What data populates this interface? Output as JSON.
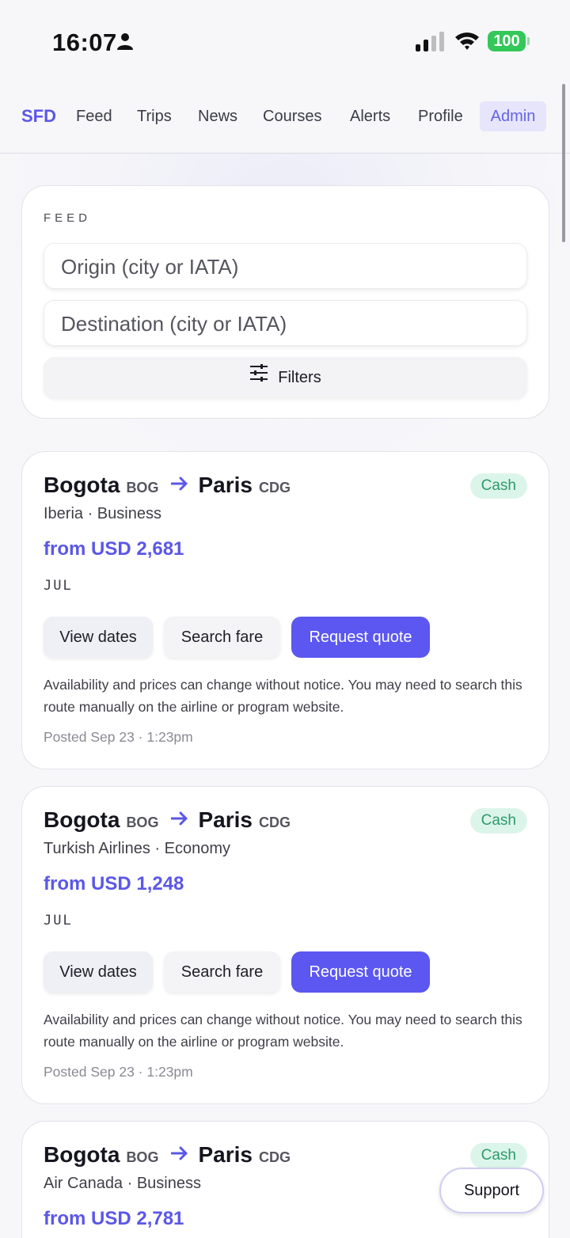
{
  "status_bar": {
    "time": "16:07",
    "battery": "100",
    "icons": [
      "person-icon",
      "signal-icon",
      "wifi-icon",
      "battery-icon"
    ]
  },
  "nav": {
    "brand": "SFD",
    "items": [
      {
        "label": "Feed"
      },
      {
        "label": "Trips"
      },
      {
        "label": "News"
      },
      {
        "label": "Courses"
      },
      {
        "label": "Alerts"
      },
      {
        "label": "Profile"
      },
      {
        "label": "Admin"
      }
    ]
  },
  "feed": {
    "section_label": "FEED",
    "origin_placeholder": "Origin (city or IATA)",
    "destination_placeholder": "Destination (city or IATA)",
    "filters_label": "Filters"
  },
  "listings": [
    {
      "origin_city": "Bogota",
      "origin_code": "BOG",
      "dest_city": "Paris",
      "dest_code": "CDG",
      "badge": "Cash",
      "airline_class": "Iberia · Business",
      "price": "from USD 2,681",
      "month": "JUL",
      "buttons": {
        "dates": "View dates",
        "search": "Search fare",
        "quote": "Request quote"
      },
      "note": "Availability and prices can change without notice. You may need to search this route manually on the airline or program website.",
      "posted": "Posted Sep 23 · 1:23pm"
    },
    {
      "origin_city": "Bogota",
      "origin_code": "BOG",
      "dest_city": "Paris",
      "dest_code": "CDG",
      "badge": "Cash",
      "airline_class": "Turkish Airlines · Economy",
      "price": "from USD 1,248",
      "month": "JUL",
      "buttons": {
        "dates": "View dates",
        "search": "Search fare",
        "quote": "Request quote"
      },
      "note": "Availability and prices can change without notice. You may need to search this route manually on the airline or program website.",
      "posted": "Posted Sep 23 · 1:23pm"
    },
    {
      "origin_city": "Bogota",
      "origin_code": "BOG",
      "dest_city": "Paris",
      "dest_code": "CDG",
      "badge": "Cash",
      "airline_class": "Air Canada · Business",
      "price": "from USD 2,781"
    }
  ],
  "support_label": "Support",
  "colors": {
    "accent": "#5b57e8",
    "cash_badge_bg": "#dcf5ea",
    "cash_badge_text": "#2e9a6c",
    "battery": "#34c759"
  }
}
